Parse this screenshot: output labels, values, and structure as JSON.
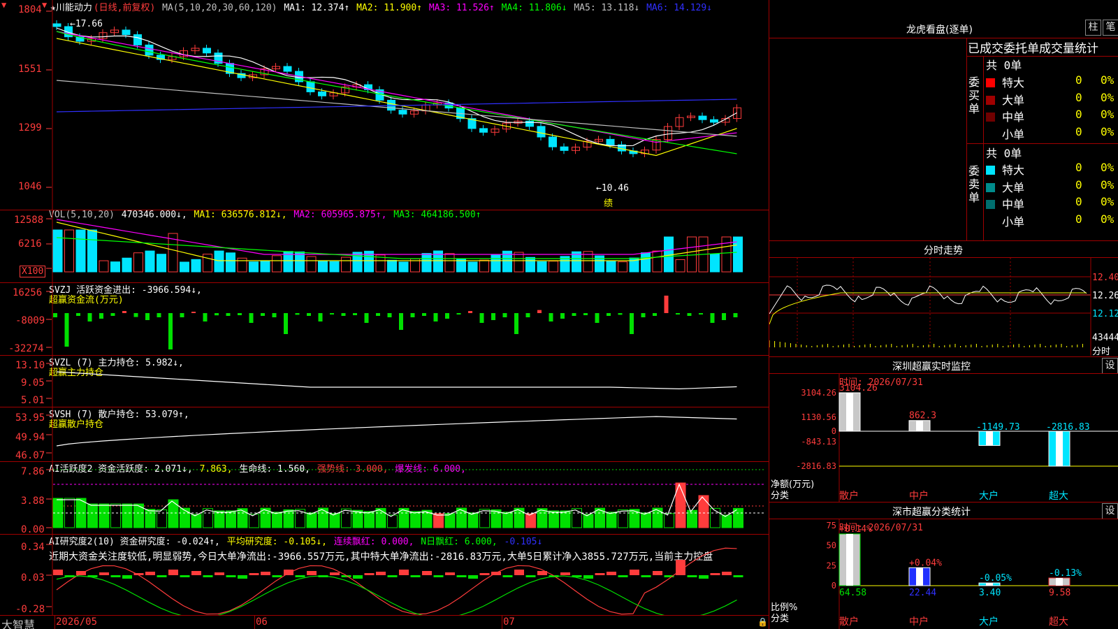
{
  "colors": {
    "up": "#ff3c3c",
    "down": "#00e5ff",
    "bg": "#000000",
    "grid": "#a00000"
  },
  "kline": {
    "stock_name": "★川能动力",
    "mode": "(日线,前复权)",
    "ma_label": "MA(5,10,20,30,60,120)",
    "ma_values": [
      {
        "label": "MA1: 12.374↑",
        "color": "#ffffff"
      },
      {
        "label": "MA2: 11.900↑",
        "color": "#ffff00"
      },
      {
        "label": "MA3: 11.526↑",
        "color": "#ff00ff"
      },
      {
        "label": "MA4: 11.806↓",
        "color": "#00ff00"
      },
      {
        "label": "MA5: 13.118↓",
        "color": "#c0c0c0"
      },
      {
        "label": "MA6: 14.129↓",
        "color": "#3030ff"
      }
    ],
    "axis": [
      "1804",
      "1551",
      "1299",
      "1046"
    ],
    "high_label": "17.66",
    "low_label": "10.46",
    "note": "绩"
  },
  "vol": {
    "label": "VOL(5,10,20)",
    "value": "470346.000↓,",
    "ma1": "MA1: 636576.812↓,",
    "ma2": "MA2: 605965.875↑,",
    "ma3": "MA3: 464186.500↑",
    "axis": [
      "12588",
      "6216"
    ],
    "unit": "X100"
  },
  "svzj": {
    "label": "SVZJ  活跃资金进出: -3966.594↓,",
    "sub": "超赢资金流(万元)",
    "axis": [
      "16256",
      "-8009",
      "-32274"
    ]
  },
  "svzl": {
    "label": "SVZL (7) 主力持仓: 5.982↓,",
    "sub": "超赢主力持仓",
    "axis": [
      "13.10",
      "9.05",
      "5.01"
    ]
  },
  "svsh": {
    "label": "SVSH (7) 散户持仓: 53.079↑,",
    "sub": "超赢散户持仓",
    "axis": [
      "53.95",
      "49.94",
      "46.07"
    ]
  },
  "ai1": {
    "parts": [
      {
        "t": "AI活跃度2 资金活跃度: 2.071↓,",
        "c": "#ffffff"
      },
      {
        "t": " 7.863,",
        "c": "#ffff00"
      },
      {
        "t": " 生命线: 1.560,",
        "c": "#ffffff"
      },
      {
        "t": " 强势线: 3.000,",
        "c": "#ff3c3c"
      },
      {
        "t": " 爆发线: 6.000,",
        "c": "#ff00ff"
      }
    ],
    "axis": [
      "7.86",
      "3.88",
      "0.00"
    ]
  },
  "ai2": {
    "parts": [
      {
        "t": "AI研究度2(10) 资金研究度: -0.024↑,",
        "c": "#ffffff"
      },
      {
        "t": " 平均研究度: -0.105↓,",
        "c": "#ffff00"
      },
      {
        "t": " 连续飘红: 0.000,",
        "c": "#ff00ff"
      },
      {
        "t": " N日飘红: 6.000,",
        "c": "#00ff00"
      },
      {
        "t": " -0.105↓",
        "c": "#3030ff"
      }
    ],
    "comment": "近期大资金关注度较低,明显弱势,今日大单净流出:-3966.557万元,其中特大单净流出:-2816.83万元,大单5日累计净入3855.727万元,当前主力控盘",
    "axis": [
      "0.34",
      "0.03",
      "-0.28"
    ]
  },
  "bottom": {
    "brand": "大智慧",
    "dates": [
      "2026/05",
      "06",
      "07"
    ]
  },
  "right": {
    "dragon_title": "龙虎看盘(逐单)",
    "btn_zhu": "柱",
    "btn_bi": "笔",
    "tabs": [
      "已成交",
      "委托单",
      "成交量统计"
    ],
    "buy_label": "委买单",
    "sell_label": "委卖单",
    "buy_total": "共 0单",
    "sell_total": "共 0单",
    "buy_rows": [
      {
        "name": "特大",
        "color": "#ff0000",
        "n": "0",
        "p": "0%"
      },
      {
        "name": "大单",
        "color": "#a00000",
        "n": "0",
        "p": "0%"
      },
      {
        "name": "中单",
        "color": "#700000",
        "n": "0",
        "p": "0%"
      },
      {
        "name": "小单",
        "color": "#000000",
        "n": "0",
        "p": "0%"
      }
    ],
    "sell_rows": [
      {
        "name": "特大",
        "color": "#00e5ff",
        "n": "0",
        "p": "0%"
      },
      {
        "name": "大单",
        "color": "#008c8c",
        "n": "0",
        "p": "0%"
      },
      {
        "name": "中单",
        "color": "#006e6e",
        "n": "0",
        "p": "0%"
      },
      {
        "name": "小单",
        "color": "#000000",
        "n": "0",
        "p": "0%"
      }
    ],
    "intraday_title": "分时走势",
    "intraday_axis": [
      "12.40",
      "12.26",
      "12.12",
      "43444",
      "分时"
    ],
    "monitor_title": "深圳超赢实时监控",
    "monitor_set": "设",
    "monitor_time": "时间: 2026/07/31",
    "monitor_axis": [
      "3104.26",
      "1130.56",
      "0",
      "-843.13",
      "-2816.83"
    ],
    "monitor_ylabel": "净额(万元)",
    "monitor_xlabel": "分类",
    "monitor_bars": [
      {
        "cat": "散户",
        "label": "3104.26",
        "value": 3104.26
      },
      {
        "cat": "中户",
        "label": "862.3",
        "value": 862.3
      },
      {
        "cat": "大户",
        "label": "-1149.73",
        "value": -1149.73
      },
      {
        "cat": "超大",
        "label": "-2816.83",
        "value": -2816.83
      }
    ],
    "class_title": "深市超赢分类统计",
    "class_set": "设",
    "class_time": "时间: 2026/07/31",
    "class_axis": [
      "75",
      "50",
      "25",
      "0"
    ],
    "class_ylabel": "比例%",
    "class_xlabel": "分类",
    "class_bars": [
      {
        "cat": "散户",
        "top": "+0.14%",
        "bottom": "64.58",
        "value": 64.58
      },
      {
        "cat": "中户",
        "top": "+0.04%",
        "bottom": "22.44",
        "value": 22.44
      },
      {
        "cat": "大户",
        "top": "-0.05%",
        "bottom": "3.40",
        "value": 3.4
      },
      {
        "cat": "超大",
        "top": "-0.13%",
        "bottom": "9.58",
        "value": 9.58
      }
    ]
  },
  "chart_data": {
    "type": "bar",
    "title": "深圳超赢实时监控",
    "categories": [
      "散户",
      "中户",
      "大户",
      "超大"
    ],
    "values": [
      3104.26,
      862.3,
      -1149.73,
      -2816.83
    ],
    "ylabel": "净额(万元)",
    "ylim": [
      -2816.83,
      3104.26
    ]
  }
}
